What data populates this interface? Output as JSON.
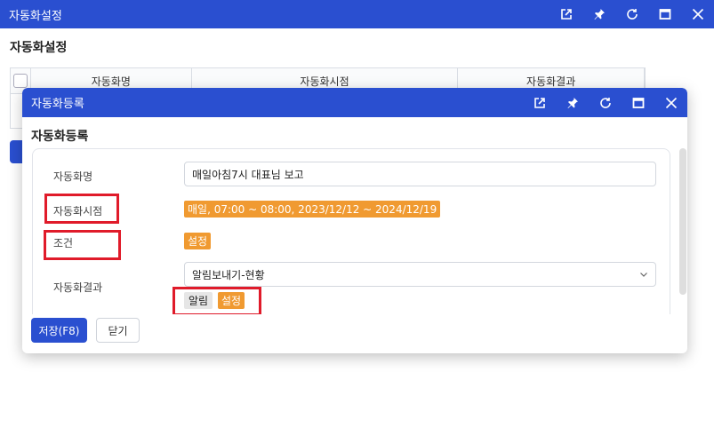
{
  "window": {
    "title": "자동화설정"
  },
  "page": {
    "heading": "자동화설정"
  },
  "bg_table": {
    "columns": [
      "자동화명",
      "자동화시점",
      "자동화결과"
    ]
  },
  "dialog": {
    "title": "자동화등록",
    "heading": "자동화등록",
    "fields": {
      "name_label": "자동화명",
      "name_value": "매일아침7시 대표님 보고",
      "timing_label": "자동화시점",
      "timing_value": "매일, 07:00 ~ 08:00, 2023/12/12 ~ 2024/12/19",
      "condition_label": "조건",
      "condition_value": "설정",
      "result_label": "자동화결과",
      "result_select": "알림보내기-현황",
      "result_tag_gray": "알림",
      "result_tag_orange": "설정"
    },
    "buttons": {
      "save": "저장(F8)",
      "close": "닫기"
    }
  },
  "colors": {
    "titlebar": "#2a4fd0",
    "accent_orange": "#f09a31",
    "highlight_red": "#e01b2a"
  }
}
